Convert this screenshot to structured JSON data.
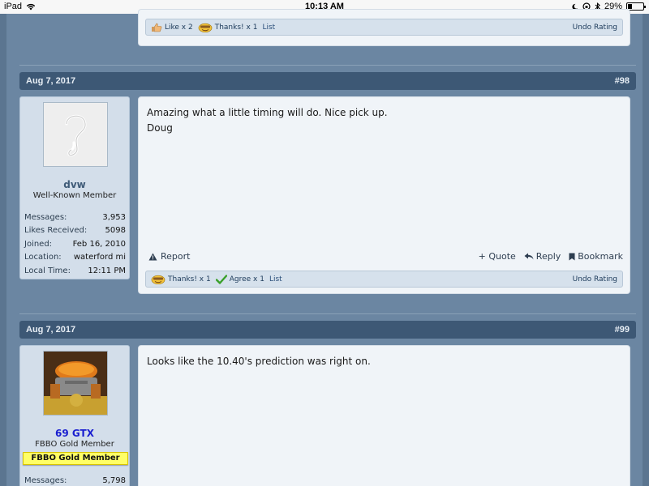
{
  "status_bar": {
    "device": "iPad",
    "time": "10:13 AM",
    "battery": "29%",
    "battery_level": 0.29
  },
  "post_prev": {
    "ratings": [
      {
        "icon": "like-icon",
        "label": "Like x 2"
      },
      {
        "icon": "thanks-icon",
        "label": "Thanks! x 1"
      }
    ],
    "list_label": "List",
    "undo_label": "Undo Rating"
  },
  "post_98": {
    "date": "Aug 7, 2017",
    "number": "#98",
    "user": {
      "name": "dvw",
      "title": "Well-Known Member",
      "avatar": "question-mark-avatar",
      "stats": [
        {
          "label": "Messages:",
          "value": "3,953"
        },
        {
          "label": "Likes Received:",
          "value": "5098"
        },
        {
          "label": "Joined:",
          "value": "Feb 16, 2010"
        },
        {
          "label": "Location:",
          "value": "waterford mi"
        },
        {
          "label": "Local Time:",
          "value": "12:11 PM"
        }
      ]
    },
    "text_line1": "Amazing what a little timing will do. Nice pick up.",
    "text_line2": "Doug",
    "report_label": "Report",
    "quote_label": "+ Quote",
    "reply_label": "Reply",
    "bookmark_label": "Bookmark",
    "ratings": [
      {
        "icon": "thanks-icon",
        "label": "Thanks! x 1"
      },
      {
        "icon": "agree-check-icon",
        "label": "Agree x 1"
      }
    ],
    "list_label": "List",
    "undo_label": "Undo Rating"
  },
  "post_99": {
    "date": "Aug 7, 2017",
    "number": "#99",
    "user": {
      "name": "69 GTX",
      "title": "FBBO Gold Member",
      "banner": "FBBO Gold Member",
      "avatar": "engine-photo-avatar",
      "stats": [
        {
          "label": "Messages:",
          "value": "5,798"
        }
      ]
    },
    "text_line1": "Looks like the 10.40's prediction was right on."
  },
  "colors": {
    "background": "#5b7590",
    "date_bar": "#3d5875",
    "username_gtx": "#1a1fd0",
    "username_dvw": "#3f5b78",
    "gold_banner": "#ffff66"
  }
}
